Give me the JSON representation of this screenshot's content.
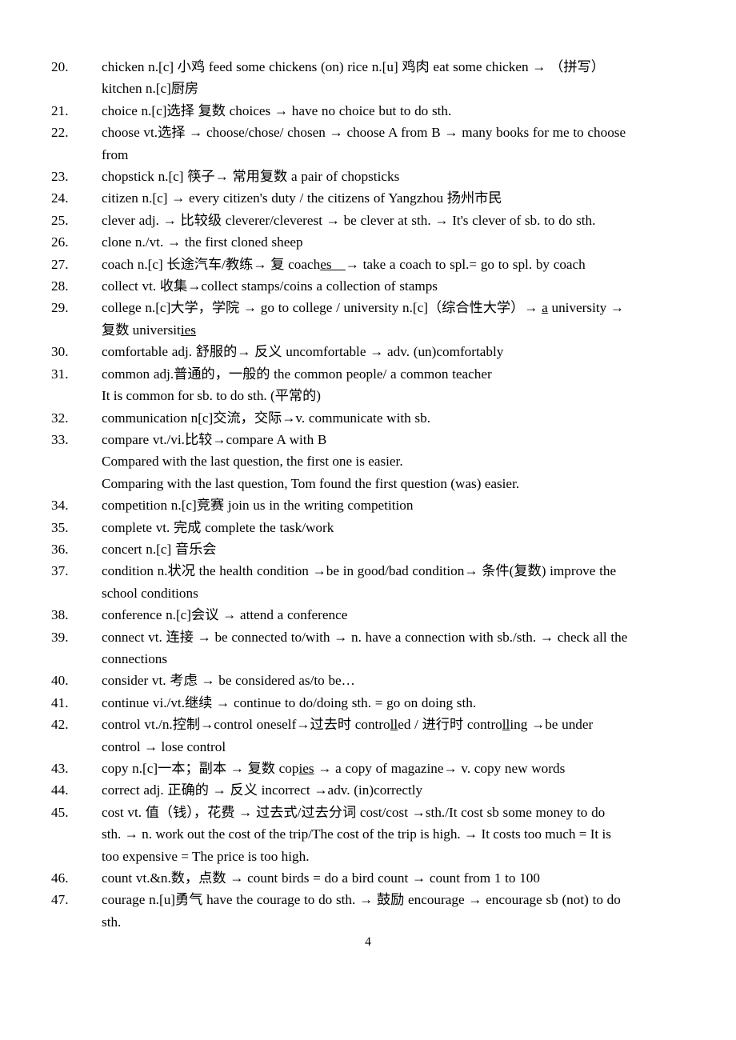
{
  "document": {
    "type": "vocabulary-word-list",
    "page_number": "4",
    "entries": [
      {
        "number": "20.",
        "lines": [
          "chicken n.[c] 小鸡 feed some chickens (on) rice n.[u] 鸡肉 eat some chicken →  （拼写）",
          "kitchen n.[c]厨房"
        ]
      },
      {
        "number": "21.",
        "lines": [
          "choice n.[c]选择 复数 choices → have no choice but to do sth."
        ]
      },
      {
        "number": "22.",
        "lines": [
          "choose vt.选择 → choose/chose/ chosen → choose A from B   → many books for me to choose",
          "from"
        ]
      },
      {
        "number": "23.",
        "lines": [
          "chopstick n.[c] 筷子→ 常用复数 a pair of chopsticks"
        ]
      },
      {
        "number": "24.",
        "lines": [
          "citizen n.[c] → every citizen's duty / the citizens of Yangzhou 扬州市民"
        ]
      },
      {
        "number": "25.",
        "lines": [
          "clever adj. → 比较级 cleverer/cleverest → be clever at sth.   → It's clever of sb. to do sth."
        ]
      },
      {
        "number": "26.",
        "lines": [
          "clone n./vt. → the first cloned sheep"
        ]
      },
      {
        "number": "27.",
        "lines_html": [
          "coach n.[c] 长途汽车/教练→ 复 coach<u class=\"ul\">es__</u>→ take a coach to spl.= go to spl. by coach"
        ]
      },
      {
        "number": "28.",
        "lines": [
          "collect vt. 收集→collect stamps/coins    a collection of stamps"
        ]
      },
      {
        "number": "29.",
        "lines_html": [
          "college n.[c]大学，学院 → go to college / university n.[c]（综合性大学）→ <u class=\"ul\">a</u> university →",
          "复数 universit<u class=\"ul\">ies</u>"
        ]
      },
      {
        "number": "30.",
        "lines": [
          "comfortable adj. 舒服的→ 反义 uncomfortable → adv. (un)comfortably"
        ]
      },
      {
        "number": "31.",
        "lines": [
          "common adj.普通的，一般的 the common people/ a common teacher",
          "It is common for sb. to do sth. (平常的)"
        ]
      },
      {
        "number": "32.",
        "lines": [
          "communication n[c]交流，交际→v. communicate with sb."
        ]
      },
      {
        "number": "33.",
        "lines": [
          "compare vt./vi.比较→compare A with B",
          "Compared with the last question, the first one is easier.",
          "Comparing with the last question, Tom found the first question (was) easier."
        ]
      },
      {
        "number": "34.",
        "lines": [
          "competition n.[c]竞赛 join us in the writing competition"
        ]
      },
      {
        "number": "35.",
        "lines": [
          "complete vt. 完成 complete the task/work"
        ]
      },
      {
        "number": "36.",
        "lines": [
          "concert n.[c] 音乐会"
        ]
      },
      {
        "number": "37.",
        "lines": [
          "condition n.状况 the health condition →be in good/bad condition→ 条件(复数) improve the",
          "school conditions"
        ]
      },
      {
        "number": "38.",
        "lines": [
          "conference n.[c]会议 → attend a conference"
        ]
      },
      {
        "number": "39.",
        "lines": [
          "connect vt. 连接 → be connected to/with → n. have a connection with sb./sth. → check all the",
          "connections"
        ]
      },
      {
        "number": "40.",
        "lines": [
          "consider vt. 考虑 → be considered as/to be…"
        ]
      },
      {
        "number": "41.",
        "lines": [
          "continue vi./vt.继续 → continue to do/doing sth. = go on doing sth."
        ]
      },
      {
        "number": "42.",
        "lines_html": [
          "control vt./n.控制→control oneself→过去时 contro<u class=\"ul\">ll</u>ed / 进行时 contro<u class=\"ul\">ll</u>ing →be under",
          "control → lose control"
        ]
      },
      {
        "number": "43.",
        "lines_html": [
          "copy n.[c]一本；副本 → 复数 cop<u class=\"ul\">ies</u> → a copy of magazine→ v. copy new words"
        ]
      },
      {
        "number": "44.",
        "lines": [
          "correct adj. 正确的 → 反义 incorrect →adv. (in)correctly"
        ]
      },
      {
        "number": "45.",
        "lines": [
          "cost vt. 值（钱），花费 → 过去式/过去分词 cost/cost →sth./It cost sb some money to do",
          "sth. → n. work out the cost of the trip/The cost of the trip is high. → It costs too much = It is",
          "too expensive = The price is too high."
        ]
      },
      {
        "number": "46.",
        "lines": [
          "count vt.&n.数，点数 → count birds = do a bird count → count from 1 to 100"
        ]
      },
      {
        "number": "47.",
        "lines": [
          "courage n.[u]勇气 have the courage to do sth. → 鼓励 encourage → encourage sb (not) to do",
          "sth."
        ]
      }
    ]
  }
}
